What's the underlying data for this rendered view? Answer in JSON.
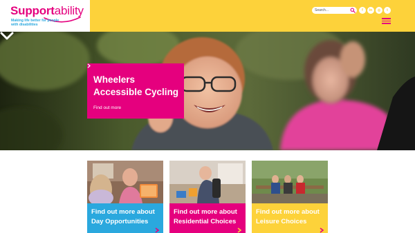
{
  "header": {
    "logo": {
      "bold": "Support",
      "light": "ability",
      "tagline": "Making life better for people with disabilities"
    },
    "search": {
      "placeholder": "Search...",
      "icon": "search-icon"
    },
    "social": [
      {
        "name": "facebook-icon",
        "glyph": "f"
      },
      {
        "name": "linkedin-icon",
        "glyph": "in"
      },
      {
        "name": "instagram-icon",
        "glyph": "◎"
      },
      {
        "name": "twitter-icon",
        "glyph": "t"
      }
    ],
    "menu_icon": "hamburger-menu-icon"
  },
  "hero": {
    "title": "Wheelers Accessible Cycling",
    "link_label": "Find out more",
    "scroll_icon": "chevron-down-icon"
  },
  "cards": [
    {
      "label": "Find out more about Day Opportunities",
      "color": "#2aa8de"
    },
    {
      "label": "Find out more about Residential Choices",
      "color": "#e5007e"
    },
    {
      "label": "Find out more about Leisure Choices",
      "color": "#fdd23a"
    }
  ],
  "colors": {
    "brand_pink": "#e5007e",
    "brand_yellow": "#fdd23a",
    "brand_blue": "#2aa8de"
  }
}
